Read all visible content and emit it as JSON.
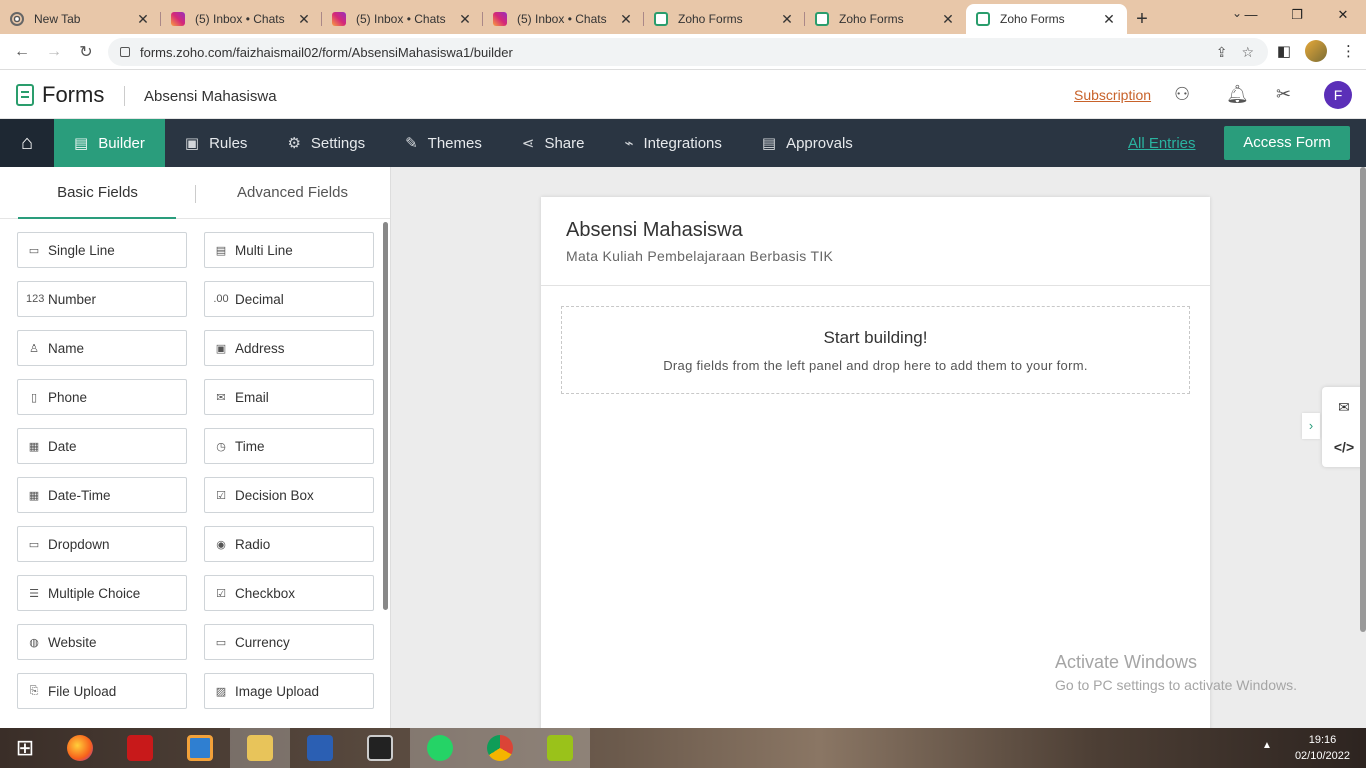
{
  "browser": {
    "tabs": [
      {
        "title": "New Tab",
        "icon": "chrome-icon"
      },
      {
        "title": "(5) Inbox • Chats",
        "icon": "instagram-icon"
      },
      {
        "title": "(5) Inbox • Chats",
        "icon": "instagram-icon"
      },
      {
        "title": "(5) Inbox • Chats",
        "icon": "instagram-icon"
      },
      {
        "title": "Zoho Forms",
        "icon": "zoho-forms-icon"
      },
      {
        "title": "Zoho Forms",
        "icon": "zoho-forms-icon"
      },
      {
        "title": "Zoho Forms",
        "icon": "zoho-forms-icon"
      }
    ],
    "url": "forms.zoho.com/faizhaismail02/form/AbsensiMahasiswa1/builder"
  },
  "header": {
    "logo_text": "Forms",
    "form_name": "Absensi Mahasiswa",
    "subscription": "Subscription",
    "user_initial": "F"
  },
  "nav": {
    "items": [
      "Builder",
      "Rules",
      "Settings",
      "Themes",
      "Share",
      "Integrations",
      "Approvals"
    ],
    "all_entries": "All Entries",
    "access_form": "Access Form"
  },
  "panel": {
    "tabs": [
      "Basic Fields",
      "Advanced Fields"
    ],
    "fields": [
      {
        "label": "Single Line",
        "icon": "single-line-icon",
        "glyph": "▭"
      },
      {
        "label": "Multi Line",
        "icon": "multi-line-icon",
        "glyph": "▤"
      },
      {
        "label": "Number",
        "icon": "number-icon",
        "glyph": "123"
      },
      {
        "label": "Decimal",
        "icon": "decimal-icon",
        "glyph": ".00"
      },
      {
        "label": "Name",
        "icon": "name-icon",
        "glyph": "♙"
      },
      {
        "label": "Address",
        "icon": "address-icon",
        "glyph": "▣"
      },
      {
        "label": "Phone",
        "icon": "phone-icon",
        "glyph": "▯"
      },
      {
        "label": "Email",
        "icon": "email-icon",
        "glyph": "✉"
      },
      {
        "label": "Date",
        "icon": "date-icon",
        "glyph": "▦"
      },
      {
        "label": "Time",
        "icon": "time-icon",
        "glyph": "◷"
      },
      {
        "label": "Date-Time",
        "icon": "date-time-icon",
        "glyph": "▦"
      },
      {
        "label": "Decision Box",
        "icon": "decision-box-icon",
        "glyph": "☑"
      },
      {
        "label": "Dropdown",
        "icon": "dropdown-icon",
        "glyph": "▭"
      },
      {
        "label": "Radio",
        "icon": "radio-icon",
        "glyph": "◉"
      },
      {
        "label": "Multiple Choice",
        "icon": "multiple-choice-icon",
        "glyph": "☰"
      },
      {
        "label": "Checkbox",
        "icon": "checkbox-icon",
        "glyph": "☑"
      },
      {
        "label": "Website",
        "icon": "globe-icon",
        "glyph": "◍"
      },
      {
        "label": "Currency",
        "icon": "currency-icon",
        "glyph": "▭"
      },
      {
        "label": "File Upload",
        "icon": "file-upload-icon",
        "glyph": "⎘"
      },
      {
        "label": "Image Upload",
        "icon": "image-upload-icon",
        "glyph": "▨"
      }
    ]
  },
  "form": {
    "title": "Absensi Mahasiswa",
    "description": "Mata Kuliah Pembelajaraan Berbasis TIK",
    "dropzone_title": "Start building!",
    "dropzone_desc": "Drag fields from the left panel and drop here to add them to your form."
  },
  "watermark": {
    "line1": "Activate Windows",
    "line2": "Go to PC settings to activate Windows."
  },
  "taskbar": {
    "time": "19:16",
    "date": "02/10/2022"
  }
}
